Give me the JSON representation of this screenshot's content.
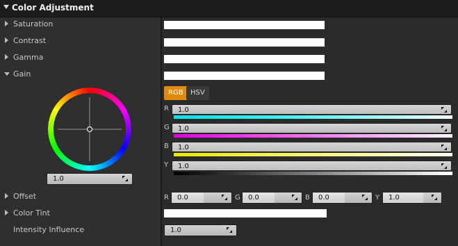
{
  "header": {
    "title": "Color Adjustment"
  },
  "props": {
    "saturation": "Saturation",
    "contrast": "Contrast",
    "gamma": "Gamma",
    "gain": "Gain",
    "offset": "Offset",
    "color_tint": "Color Tint",
    "intensity_influence": "Intensity Influence"
  },
  "gain": {
    "tabs": {
      "rgb": "RGB",
      "hsv": "HSV"
    },
    "channels": [
      {
        "label": "R",
        "value": "1.0"
      },
      {
        "label": "G",
        "value": "1.0"
      },
      {
        "label": "B",
        "value": "1.0"
      },
      {
        "label": "Y",
        "value": "1.0"
      }
    ],
    "wheel_value": "1.0"
  },
  "offset": {
    "fields": [
      {
        "label": "R",
        "value": "0.0"
      },
      {
        "label": "G",
        "value": "0.0"
      },
      {
        "label": "B",
        "value": "0.0"
      },
      {
        "label": "Y",
        "value": "1.0"
      }
    ]
  },
  "intensity_influence": {
    "value": "1.0"
  },
  "colors": {
    "accent": "#e08a14",
    "panel": "#2b2b2b",
    "header": "#1d1d1d"
  },
  "icons": [
    "expand-triangle-icon",
    "collapse-triangle-icon",
    "color-wheel-icon",
    "resize-handle-icon"
  ]
}
